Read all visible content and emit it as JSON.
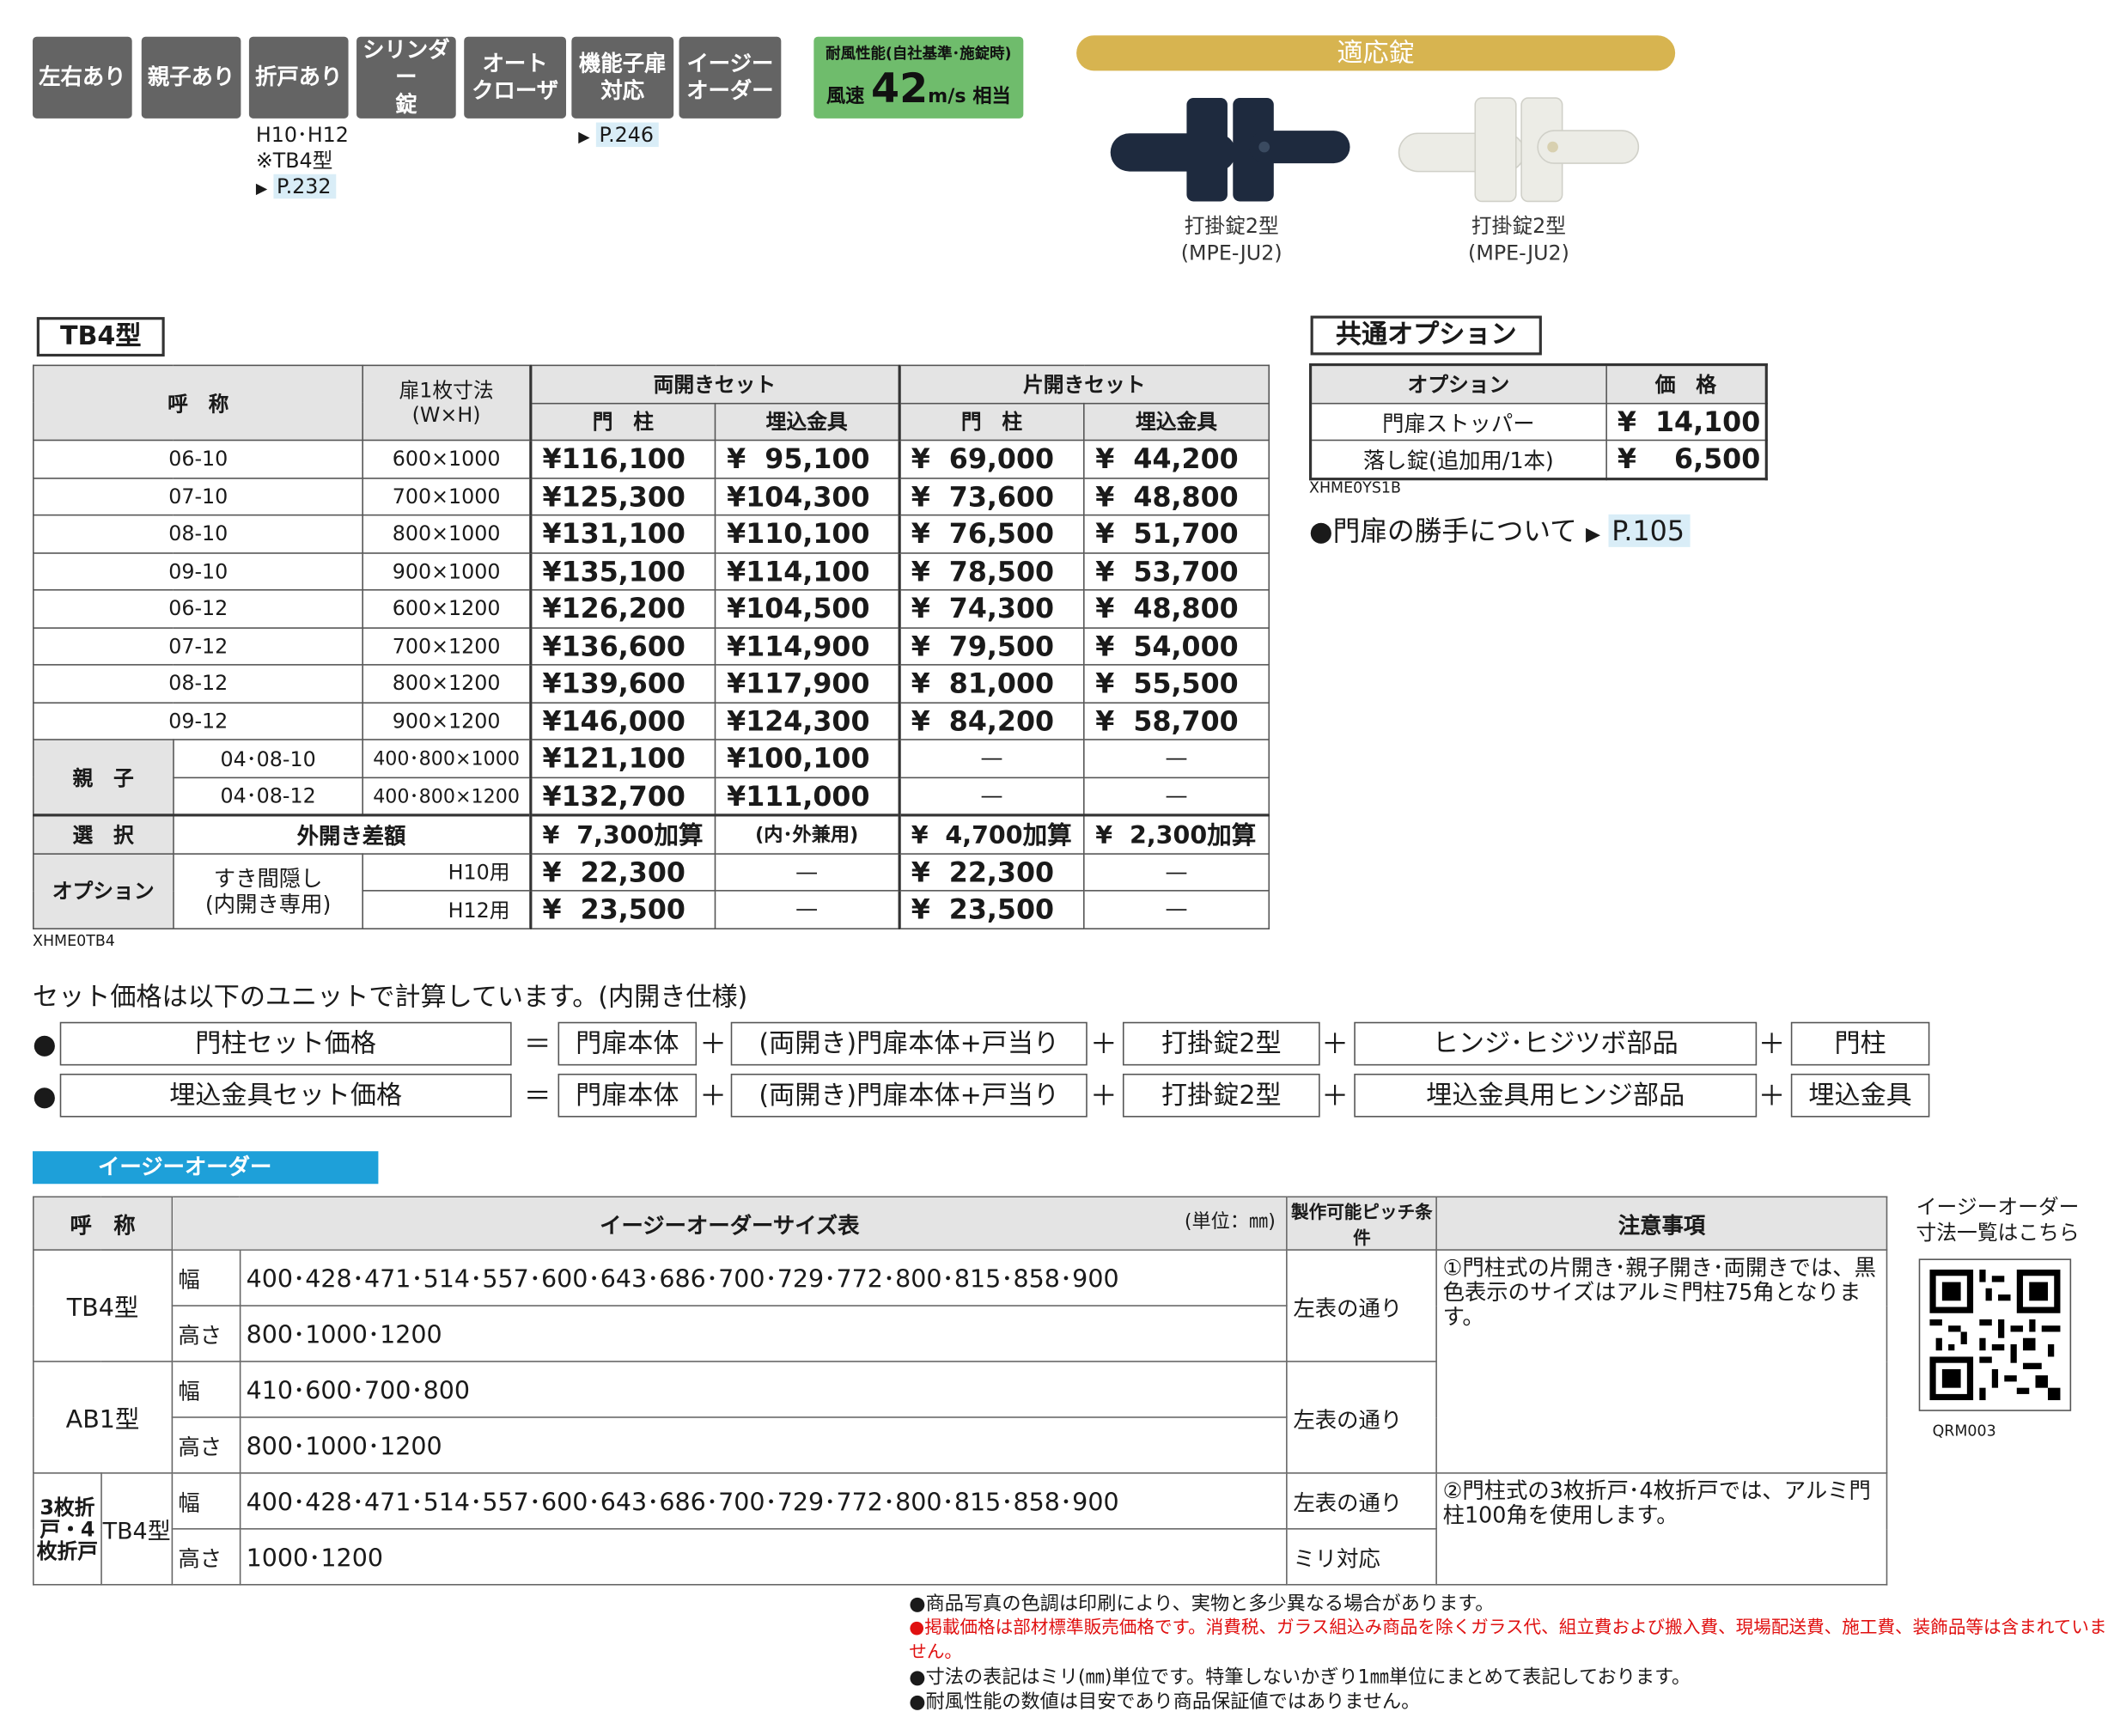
{
  "features": [
    "左右あり",
    "親子あり",
    "折戸あり",
    "シリンダー\n錠",
    "オート\nクローザ",
    "機能子扉\n対応",
    "イージー\nオーダー"
  ],
  "feature_note_door": [
    "H10･H12",
    "※TB4型"
  ],
  "feature_ref_door": "P.232",
  "feature_ref_func": "P.246",
  "wind": {
    "line1": "耐風性能(自社基準･施錠時)",
    "prefix": "風速",
    "value": "42",
    "unit": "m/s",
    "suffix": "相当"
  },
  "locks_title": "適応錠",
  "locks": [
    {
      "name": "打掛錠2型",
      "code": "(MPE-JU2)",
      "color": "#1e2a3e"
    },
    {
      "name": "打掛錠2型",
      "code": "(MPE-JU2)",
      "color": "#ecece6"
    }
  ],
  "tb4_title": "TB4型",
  "price_table": {
    "headers": {
      "name": "呼　称",
      "size": "扉1枚寸法\n(W×H)",
      "double": "両開きセット",
      "single": "片開きセット",
      "post": "門　柱",
      "embed": "埋込金具"
    },
    "rows": [
      {
        "name": "06-10",
        "size": "600×1000",
        "p": [
          "¥116,100",
          "¥  95,100",
          "¥  69,000",
          "¥  44,200"
        ]
      },
      {
        "name": "07-10",
        "size": "700×1000",
        "p": [
          "¥125,300",
          "¥104,300",
          "¥  73,600",
          "¥  48,800"
        ]
      },
      {
        "name": "08-10",
        "size": "800×1000",
        "p": [
          "¥131,100",
          "¥110,100",
          "¥  76,500",
          "¥  51,700"
        ]
      },
      {
        "name": "09-10",
        "size": "900×1000",
        "p": [
          "¥135,100",
          "¥114,100",
          "¥  78,500",
          "¥  53,700"
        ]
      },
      {
        "name": "06-12",
        "size": "600×1200",
        "p": [
          "¥126,200",
          "¥104,500",
          "¥  74,300",
          "¥  48,800"
        ]
      },
      {
        "name": "07-12",
        "size": "700×1200",
        "p": [
          "¥136,600",
          "¥114,900",
          "¥  79,500",
          "¥  54,000"
        ]
      },
      {
        "name": "08-12",
        "size": "800×1200",
        "p": [
          "¥139,600",
          "¥117,900",
          "¥  81,000",
          "¥  55,500"
        ]
      },
      {
        "name": "09-12",
        "size": "900×1200",
        "p": [
          "¥146,000",
          "¥124,300",
          "¥  84,200",
          "¥  58,700"
        ]
      }
    ],
    "oyako_label": "親　子",
    "oyako_rows": [
      {
        "name": "04･08-10",
        "size": "400･800×1000",
        "p": [
          "¥121,100",
          "¥100,100",
          "―",
          "―"
        ]
      },
      {
        "name": "04･08-12",
        "size": "400･800×1200",
        "p": [
          "¥132,700",
          "¥111,000",
          "―",
          "―"
        ]
      }
    ],
    "select": {
      "label": "選　択",
      "name": "外開き差額",
      "p": [
        "¥  7,300加算",
        "(内･外兼用)",
        "¥  4,700加算",
        "¥  2,300加算"
      ]
    },
    "option": {
      "label": "オプション",
      "name": "すき間隠し\n(内開き専用)",
      "rows": [
        {
          "sub": "H10用",
          "p": [
            "¥  22,300",
            "―",
            "¥  22,300",
            "―"
          ]
        },
        {
          "sub": "H12用",
          "p": [
            "¥  23,500",
            "―",
            "¥  23,500",
            "―"
          ]
        }
      ]
    },
    "code": "XHME0TB4"
  },
  "common_options": {
    "title": "共通オプション",
    "headers": [
      "オプション",
      "価　格"
    ],
    "rows": [
      {
        "name": "門扉ストッパー",
        "price": "¥  14,100"
      },
      {
        "name": "落し錠(追加用/1本)",
        "price": "¥    6,500"
      }
    ],
    "code": "XHME0YS1B",
    "hand_note": "●門扉の勝手について",
    "hand_ref": "P.105"
  },
  "formula": {
    "intro": "セット価格は以下のユニットで計算しています。(内開き仕様)",
    "row1": [
      "門柱セット価格",
      "門扉本体",
      "(両開き)門扉本体+戸当り",
      "打掛錠2型",
      "ヒンジ･ヒジツボ部品",
      "門柱"
    ],
    "row2": [
      "埋込金具セット価格",
      "門扉本体",
      "(両開き)門扉本体+戸当り",
      "打掛錠2型",
      "埋込金具用ヒンジ部品",
      "埋込金具"
    ]
  },
  "easy_order": {
    "title": "イージーオーダー",
    "headers": {
      "name": "呼　称",
      "table": "イージーオーダーサイズ表",
      "unit": "(単位：㎜)",
      "pitch": "製作可能ピッチ条件",
      "note": "注意事項"
    },
    "rows": [
      {
        "type": "TB4型",
        "w": "400･428･471･514･557･600･643･686･700･729･772･800･815･858･900",
        "h": "800･1000･1200",
        "pitch": "左表の通り"
      },
      {
        "type": "AB1型",
        "w": "410･600･700･800",
        "h": "800･1000･1200",
        "pitch": "左表の通り"
      }
    ],
    "fold": {
      "group": "3枚折戸・4枚折戸",
      "type": "TB4型",
      "w": "400･428･471･514･557･600･643･686･700･729･772･800･815･858･900",
      "h": "1000･1200",
      "pitch_w": "左表の通り",
      "pitch_h": "ミリ対応"
    },
    "wlabel": "幅",
    "hlabel": "高さ",
    "note1": "①門柱式の片開き･親子開き･両開きでは、黒色表示のサイズはアルミ門柱75角となります。",
    "note2": "②門柱式の3枚折戸･4枚折戸では、アルミ門柱100角を使用します。",
    "qr_caption": "イージーオーダー\n寸法一覧はこちら",
    "qr_code": "QRM003"
  },
  "footnotes": [
    "●商品写真の色調は印刷により、実物と多少異なる場合があります。",
    "●掲載価格は部材標準販売価格です。消費税、ガラス組込み商品を除くガラス代、組立費および搬入費、現場配送費、施工費、装飾品等は含まれていません。",
    "●寸法の表記はミリ(㎜)単位です。特筆しないかぎり1㎜単位にまとめて表記しております。",
    "●耐風性能の数値は目安であり商品保証値ではありません。"
  ]
}
